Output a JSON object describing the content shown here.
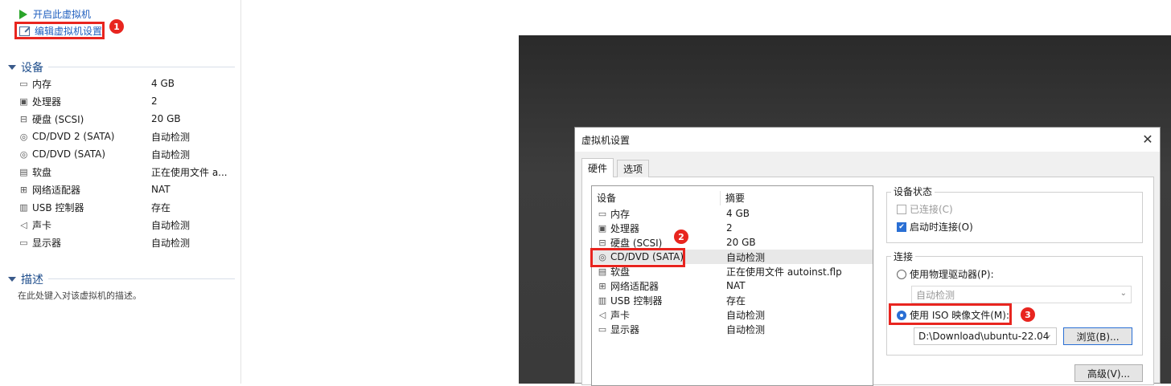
{
  "left": {
    "actions": {
      "power_on": "开启此虚拟机",
      "edit_settings": "编辑虚拟机设置"
    },
    "devices_title": "设备",
    "devices": [
      {
        "icon": "memory-icon",
        "name": "内存",
        "value": "4 GB"
      },
      {
        "icon": "processor-icon",
        "name": "处理器",
        "value": "2"
      },
      {
        "icon": "harddisk-icon",
        "name": "硬盘 (SCSI)",
        "value": "20 GB"
      },
      {
        "icon": "cd-icon",
        "name": "CD/DVD 2 (SATA)",
        "value": "自动检测"
      },
      {
        "icon": "cd-icon",
        "name": "CD/DVD (SATA)",
        "value": "自动检测"
      },
      {
        "icon": "floppy-icon",
        "name": "软盘",
        "value": "正在使用文件 a..."
      },
      {
        "icon": "network-icon",
        "name": "网络适配器",
        "value": "NAT"
      },
      {
        "icon": "usb-icon",
        "name": "USB 控制器",
        "value": "存在"
      },
      {
        "icon": "sound-icon",
        "name": "声卡",
        "value": "自动检测"
      },
      {
        "icon": "display-icon",
        "name": "显示器",
        "value": "自动检测"
      }
    ],
    "description_title": "描述",
    "description_placeholder": "在此处键入对该虚拟机的描述。"
  },
  "badges": {
    "b1": "1",
    "b2": "2",
    "b3": "3"
  },
  "dialog": {
    "title": "虚拟机设置",
    "tabs": [
      "硬件",
      "选项"
    ],
    "list_headers": {
      "device": "设备",
      "summary": "摘要"
    },
    "hardware": [
      {
        "icon": "memory-icon",
        "name": "内存",
        "value": "4 GB"
      },
      {
        "icon": "processor-icon",
        "name": "处理器",
        "value": "2"
      },
      {
        "icon": "harddisk-icon",
        "name": "硬盘 (SCSI)",
        "value": "20 GB"
      },
      {
        "icon": "cd-icon",
        "name": "CD/DVD (SATA)",
        "value": "自动检测"
      },
      {
        "icon": "floppy-icon",
        "name": "软盘",
        "value": "正在使用文件 autoinst.flp"
      },
      {
        "icon": "network-icon",
        "name": "网络适配器",
        "value": "NAT"
      },
      {
        "icon": "usb-icon",
        "name": "USB 控制器",
        "value": "存在"
      },
      {
        "icon": "sound-icon",
        "name": "声卡",
        "value": "自动检测"
      },
      {
        "icon": "display-icon",
        "name": "显示器",
        "value": "自动检测"
      }
    ],
    "device_status": {
      "title": "设备状态",
      "connected": "已连接(C)",
      "connect_on_power": "启动时连接(O)"
    },
    "connection": {
      "title": "连接",
      "physical_drive": "使用物理驱动器(P):",
      "physical_select": "自动检测",
      "iso_image": "使用 ISO 映像文件(M):",
      "iso_path": "D:\\Download\\ubuntu-22.04",
      "browse": "浏览(B)...",
      "advanced": "高级(V)..."
    }
  },
  "colors": {
    "accent": "#2a6fd4",
    "highlight": "#e8251f",
    "link": "#1f5fbf"
  }
}
